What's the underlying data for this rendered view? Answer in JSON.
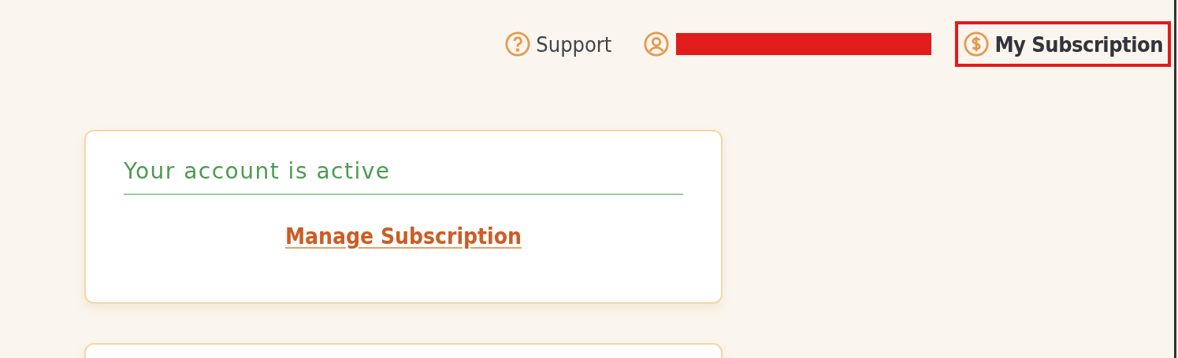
{
  "nav": [
    {
      "kind": "help",
      "label": "Support",
      "selected": false,
      "highlighted": false
    },
    {
      "kind": "account",
      "redacted": true
    },
    {
      "kind": "billing",
      "label": "My Subscription",
      "selected": true,
      "highlighted": true
    }
  ],
  "cards": [
    {
      "kind": "status",
      "title": "Your account is active",
      "action": "Manage Subscription"
    },
    {
      "kind": "empty"
    }
  ]
}
